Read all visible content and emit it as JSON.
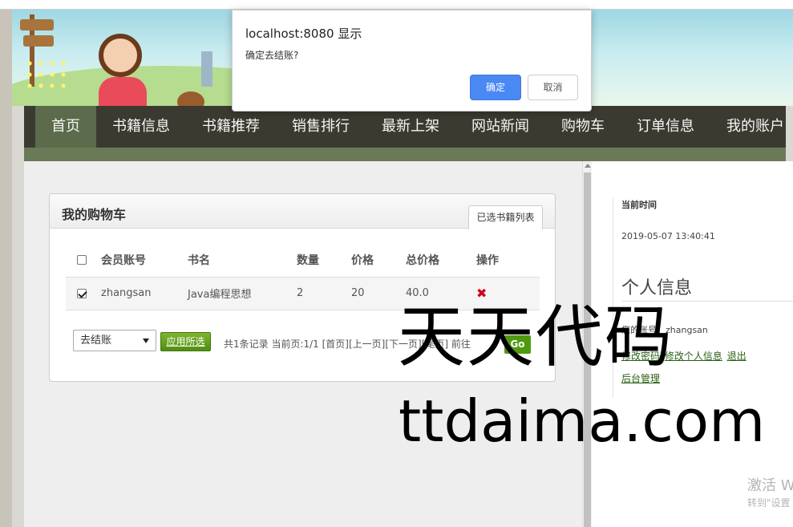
{
  "dialog": {
    "title": "localhost:8080 显示",
    "message": "确定去结账?",
    "ok_label": "确定",
    "cancel_label": "取消"
  },
  "nav": {
    "items": [
      "首页",
      "书籍信息",
      "书籍推荐",
      "销售排行",
      "最新上架",
      "网站新闻",
      "购物车",
      "订单信息",
      "我的账户"
    ],
    "active_index": 0
  },
  "cart_panel": {
    "title": "我的购物车",
    "tab_label": "已选书籍列表",
    "columns": [
      "会员账号",
      "书名",
      "数量",
      "价格",
      "总价格",
      "操作"
    ],
    "rows": [
      {
        "account": "zhangsan",
        "book": "Java编程思想",
        "quantity": "2",
        "price": "20",
        "total": "40.0",
        "checked": true
      }
    ],
    "delete_icon": "✖"
  },
  "actions": {
    "select_value": "去结账",
    "apply_label": "应用所选",
    "pager_text": "共1条记录 当前页:1/1 [首页][上一页][下一页][尾页] 前往",
    "go_label": "Go"
  },
  "sidebar": {
    "time_label": "当前时间",
    "time_value": "2019-05-07 13:40:41",
    "heading": "个人信息",
    "account_text": "您的账号：zhangsan",
    "links": [
      "修改密码",
      "修改个人信息",
      "退出"
    ],
    "admin_link": "后台管理"
  },
  "system": {
    "activate_title": "激活 W",
    "activate_sub": "转到\"设置"
  },
  "watermark": {
    "line1": "天天代码",
    "line2": "ttdaima.com"
  },
  "colors": {
    "nav_bg": "#3b3a31",
    "nav_active": "#5c6b4b",
    "accent_green": "#4f9a0f",
    "dialog_ok": "#4a89f3",
    "delete_red": "#d0021b"
  }
}
